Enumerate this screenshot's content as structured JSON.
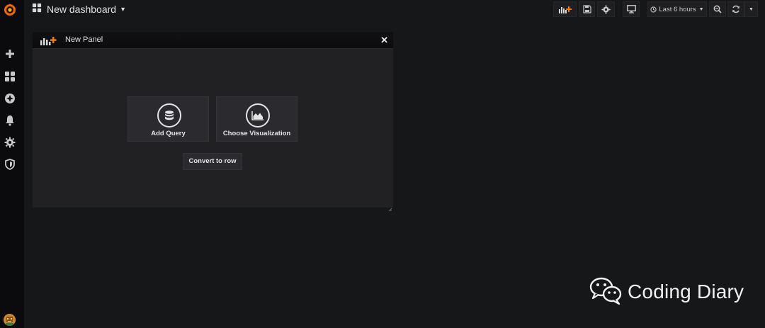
{
  "colors": {
    "background": "#161719",
    "sidebar": "#0b0b0d",
    "panel": "#212124",
    "logo_accent": "#f46800",
    "add_panel_accent": "#eb7b18"
  },
  "sidebar": {
    "logo": "grafana-logo",
    "items": [
      {
        "icon": "plus-icon",
        "tooltip_label": "Create"
      },
      {
        "icon": "dashboards-icon",
        "tooltip_label": "Dashboards"
      },
      {
        "icon": "explore-icon",
        "tooltip_label": "Explore"
      },
      {
        "icon": "bell-icon",
        "tooltip_label": "Alerting"
      },
      {
        "icon": "gear-icon",
        "tooltip_label": "Configuration"
      },
      {
        "icon": "shield-icon",
        "tooltip_label": "Server Admin"
      }
    ],
    "avatar": "user-avatar"
  },
  "topbar": {
    "title": "New dashboard",
    "time_range": "Last 6 hours",
    "buttons": [
      "add-panel-icon",
      "save-icon",
      "gear-icon",
      "monitor-icon",
      "clock-icon",
      "zoom-out-icon",
      "refresh-icon",
      "caret-down-icon"
    ]
  },
  "panel": {
    "title": "New Panel",
    "add_query_label": "Add Query",
    "choose_visualization_label": "Choose Visualization",
    "convert_to_row_label": "Convert to row"
  },
  "watermark": {
    "text": "Coding Diary"
  }
}
